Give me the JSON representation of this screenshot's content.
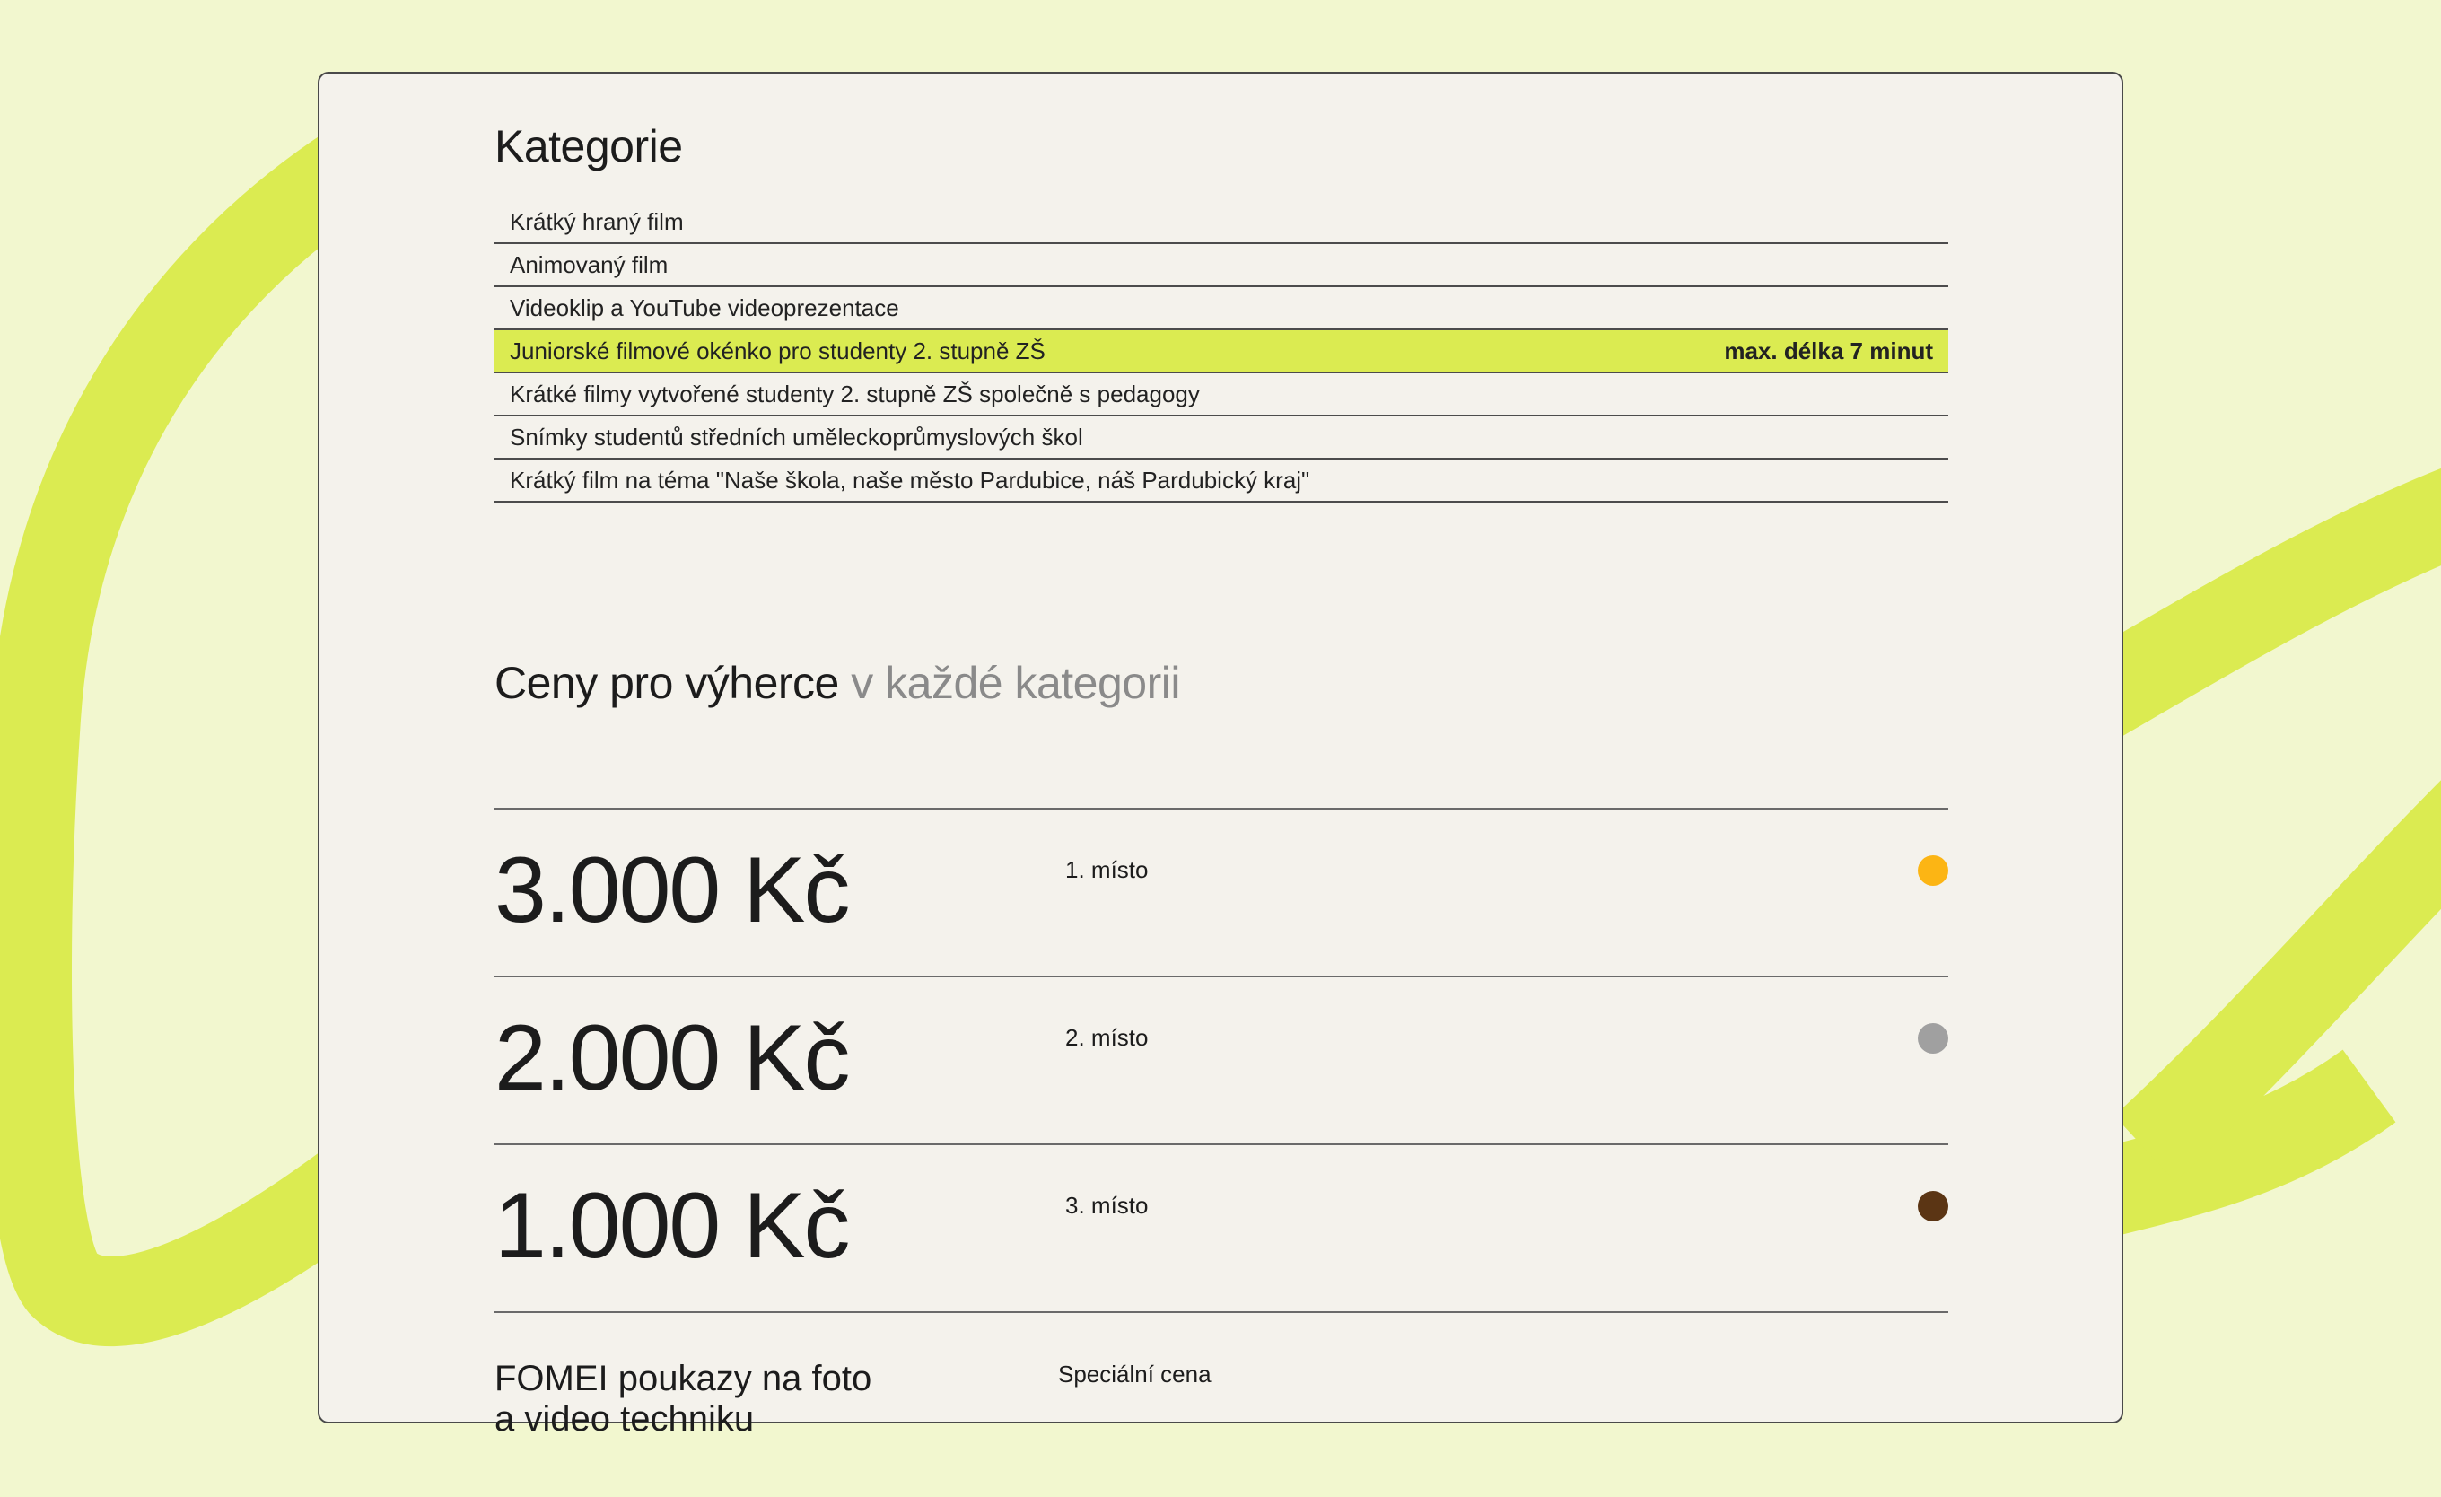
{
  "colors": {
    "page_background": "#f2f7cf",
    "swirl": "#dbeb51",
    "card_background": "#f4f2ec",
    "highlight_row": "#dbeb51",
    "muted_text": "#8a8a8a",
    "gold": "#fcb514",
    "silver": "#a0a0a0",
    "bronze": "#5b3514"
  },
  "categories": {
    "title": "Kategorie",
    "items": [
      {
        "label": "Krátký hraný film",
        "note": ""
      },
      {
        "label": "Animovaný film",
        "note": ""
      },
      {
        "label": "Videoklip a YouTube videoprezentace",
        "note": ""
      },
      {
        "label": "Juniorské filmové okénko pro studenty 2. stupně ZŠ",
        "note": "max. délka 7 minut"
      },
      {
        "label": "Krátké filmy vytvořené studenty 2. stupně ZŠ společně s pedagogy",
        "note": ""
      },
      {
        "label": "Snímky studentů středních uměleckoprůmyslových škol",
        "note": ""
      },
      {
        "label": "Krátký film na téma \"Naše škola, naše město Pardubice, náš Pardubický kraj\"",
        "note": ""
      }
    ]
  },
  "prizes": {
    "title_main": "Ceny pro výherce",
    "title_muted": "v každé kategorii",
    "items": [
      {
        "amount": "3.000 Kč",
        "place": "1. místo",
        "dot_color": "#fcb514"
      },
      {
        "amount": "2.000 Kč",
        "place": "2. místo",
        "dot_color": "#a0a0a0"
      },
      {
        "amount": "1.000 Kč",
        "place": "3. místo",
        "dot_color": "#5b3514"
      }
    ],
    "special": {
      "title_line1": "FOMEI poukazy na foto",
      "title_line2": "a video techniku",
      "label": "Speciální cena"
    }
  }
}
